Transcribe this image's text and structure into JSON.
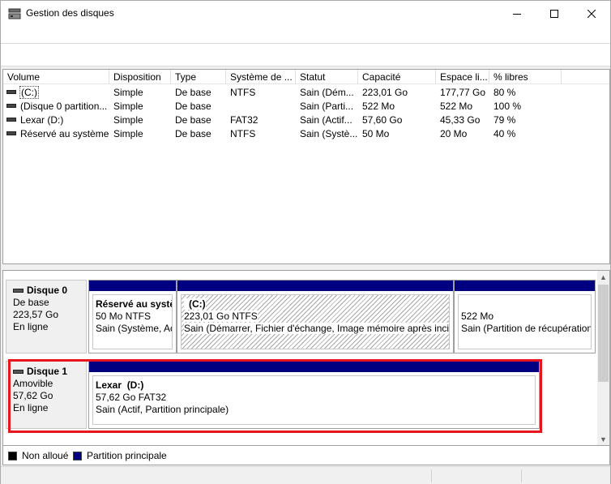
{
  "window": {
    "title": "Gestion des disques",
    "icon": "disk-management-icon",
    "controls": [
      "minimize-icon",
      "maximize-icon",
      "close-icon"
    ]
  },
  "volumes": {
    "columns": [
      "Volume",
      "Disposition",
      "Type",
      "Système de ...",
      "Statut",
      "Capacité",
      "Espace li...",
      "% libres"
    ],
    "rows": [
      [
        "(C:)",
        "Simple",
        "De base",
        "NTFS",
        "Sain (Dém...",
        "223,01 Go",
        "177,77 Go",
        "80 %"
      ],
      [
        "(Disque 0 partition...",
        "Simple",
        "De base",
        "",
        "Sain (Parti...",
        "522 Mo",
        "522 Mo",
        "100 %"
      ],
      [
        "Lexar (D:)",
        "Simple",
        "De base",
        "FAT32",
        "Sain (Actif...",
        "57,60 Go",
        "45,33 Go",
        "79 %"
      ],
      [
        "Réservé au système",
        "Simple",
        "De base",
        "NTFS",
        "Sain (Systè...",
        "50 Mo",
        "20 Mo",
        "40 %"
      ]
    ]
  },
  "disks": [
    {
      "name": "Disque 0",
      "kind": "De base",
      "size": "223,57 Go",
      "state": "En ligne",
      "partitions": [
        {
          "title": "Réservé au systè",
          "line1": "50 Mo NTFS",
          "line2": "Sain (Système, Ac"
        },
        {
          "title": "(C:)",
          "line1": "223,01 Go NTFS",
          "line2": "Sain (Démarrer, Fichier d'échange, Image mémoire après incid"
        },
        {
          "title": "",
          "line1": "522 Mo",
          "line2": "Sain (Partition de récupération"
        }
      ]
    },
    {
      "name": "Disque 1",
      "kind": "Amovible",
      "size": "57,62 Go",
      "state": "En ligne",
      "partitions": [
        {
          "title": "Lexar  (D:)",
          "line1": "57,62 Go FAT32",
          "line2": "Sain (Actif, Partition principale)"
        }
      ]
    }
  ],
  "legend": [
    {
      "label": "Non alloué",
      "color": "#000000"
    },
    {
      "label": "Partition principale",
      "color": "#000080"
    }
  ],
  "colors": {
    "partition_band": "#000080",
    "highlight": "#e8141e"
  }
}
